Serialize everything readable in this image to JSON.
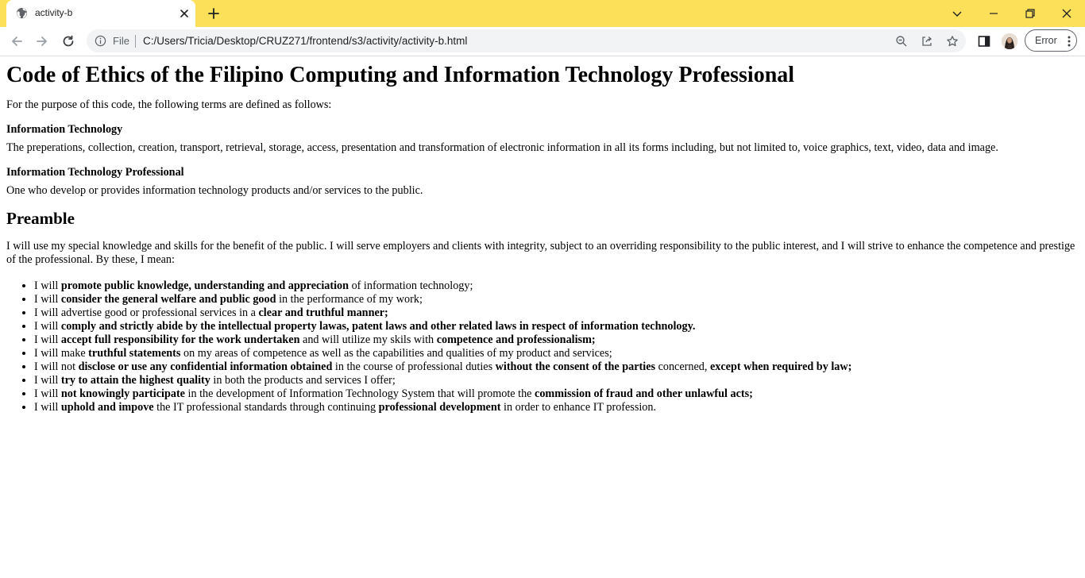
{
  "tab": {
    "title": "activity-b",
    "favicon": "globe-icon"
  },
  "address_bar": {
    "security_label": "File",
    "url": "C:/Users/Tricia/Desktop/CRUZ271/frontend/s3/activity/activity-b.html"
  },
  "profile": {
    "error_label": "Error"
  },
  "colors": {
    "tabstrip": "#fde05a",
    "omnibox": "#f1f3f4"
  },
  "page": {
    "title": "Code of Ethics of the Filipino Computing and Information Technology Professional",
    "intro": "For the purpose of this code, the following terms are defined as follows:",
    "terms": [
      {
        "term": "Information Technology",
        "definition": "The preperations, collection, creation, transport, retrieval, storage, access, presentation and transformation of electronic information in all its forms including, but not limited to, voice graphics, text, video, data and image."
      },
      {
        "term": "Information Technology Professional",
        "definition": "One who develop or provides information technology products and/or services to the public."
      }
    ],
    "preamble_heading": "Preamble",
    "preamble_text": "I will use my special knowledge and skills for the benefit of the public. I will serve employers and clients with integrity, subject to an overriding responsibility to the public interest, and I will strive to enhance the competence and prestige of the professional. By these, I mean:",
    "pledges": [
      [
        {
          "t": "I will "
        },
        {
          "t": "promote public knowledge, understanding and appreciation",
          "b": true
        },
        {
          "t": " of information technology;"
        }
      ],
      [
        {
          "t": "I will "
        },
        {
          "t": "consider the general welfare and public good",
          "b": true
        },
        {
          "t": " in the performance of my work;"
        }
      ],
      [
        {
          "t": "I will advertise good or professional services in a "
        },
        {
          "t": "clear and truthful manner;",
          "b": true
        }
      ],
      [
        {
          "t": "I will "
        },
        {
          "t": "comply and strictly abide by the intellectual property lawas, patent laws and other related laws in respect of information technology.",
          "b": true
        }
      ],
      [
        {
          "t": "I will "
        },
        {
          "t": "accept full responsibility for the work undertaken",
          "b": true
        },
        {
          "t": " and will utilize my skils with "
        },
        {
          "t": "competence and professionalism;",
          "b": true
        }
      ],
      [
        {
          "t": "I will make "
        },
        {
          "t": "truthful statements",
          "b": true
        },
        {
          "t": " on my areas of competence as well as the capabilities and qualities of my product and services;"
        }
      ],
      [
        {
          "t": "I will not "
        },
        {
          "t": "disclose or use any confidential information obtained",
          "b": true
        },
        {
          "t": " in the course of professional duties "
        },
        {
          "t": "without the consent of the parties",
          "b": true
        },
        {
          "t": " concerned, "
        },
        {
          "t": "except when required by law;",
          "b": true
        }
      ],
      [
        {
          "t": "I will "
        },
        {
          "t": "try to attain the highest quality",
          "b": true
        },
        {
          "t": " in both the products and services I offer;"
        }
      ],
      [
        {
          "t": "I will "
        },
        {
          "t": "not knowingly participate",
          "b": true
        },
        {
          "t": " in the development of Information Technology System that will promote the "
        },
        {
          "t": "commission of fraud and other unlawful acts;",
          "b": true
        }
      ],
      [
        {
          "t": "I will "
        },
        {
          "t": "uphold and impove",
          "b": true
        },
        {
          "t": " the IT professional standards through continuing "
        },
        {
          "t": "professional development",
          "b": true
        },
        {
          "t": " in order to enhance IT profession."
        }
      ]
    ]
  }
}
